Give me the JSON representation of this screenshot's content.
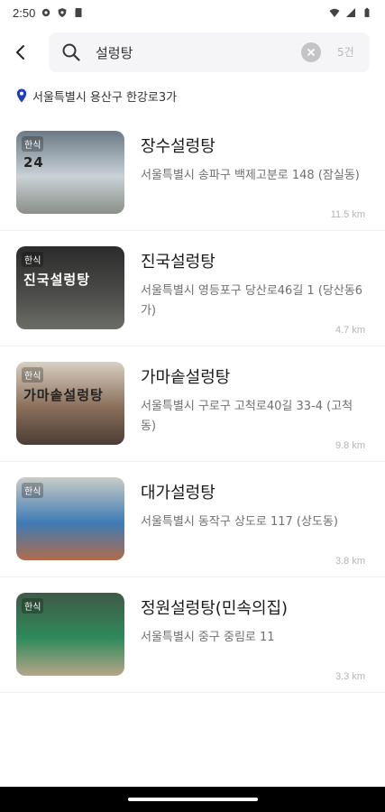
{
  "status_bar": {
    "time": "2:50",
    "left_icons": [
      "gear-icon",
      "shield-icon",
      "sd-card-icon"
    ],
    "right_icons": [
      "wifi-icon",
      "signal-icon",
      "battery-icon"
    ]
  },
  "search": {
    "query": "설렁탕",
    "result_count": "5건"
  },
  "location": {
    "text": "서울특별시 용산구 한강로3가"
  },
  "restaurants": [
    {
      "name": "장수설렁탕",
      "address": "서울특별시 송파구 백제고분로 148 (잠실동)",
      "distance": "11.5 km",
      "badge": "한식",
      "sign": "24",
      "thumb_colors": [
        "#6a7a86",
        "#c9d1d6",
        "#8b8f88"
      ]
    },
    {
      "name": "진국설렁탕",
      "address": "서울특별시 영등포구 당산로46길 1 (당산동6가)",
      "distance": "4.7 km",
      "badge": "한식",
      "sign": "진국설렁탕",
      "thumb_colors": [
        "#2b2b2b",
        "#4a4a48",
        "#6b6e66"
      ]
    },
    {
      "name": "가마솥설렁탕",
      "address": "서울특별시 구로구 고척로40길 33-4 (고척동)",
      "distance": "9.8 km",
      "badge": "한식",
      "sign": "가마솥설렁탕",
      "thumb_colors": [
        "#d8cfc2",
        "#8a6e5a",
        "#4b3d35"
      ]
    },
    {
      "name": "대가설렁탕",
      "address": "서울특별시 동작구 상도로 117 (상도동)",
      "distance": "3.8 km",
      "badge": "한식",
      "sign": "",
      "thumb_colors": [
        "#c9ccc6",
        "#3f7bb5",
        "#b06c4a"
      ]
    },
    {
      "name": "정원설렁탕(민속의집)",
      "address": "서울특별시 중구 중림로 11",
      "distance": "3.3 km",
      "badge": "한식",
      "sign": "",
      "thumb_colors": [
        "#3f5a48",
        "#2f8a5a",
        "#b7a58a"
      ]
    }
  ],
  "colors": {
    "accent_pin": "#1f3fbf",
    "search_bg": "#f5f5f7",
    "nav_bar": "#000000"
  }
}
